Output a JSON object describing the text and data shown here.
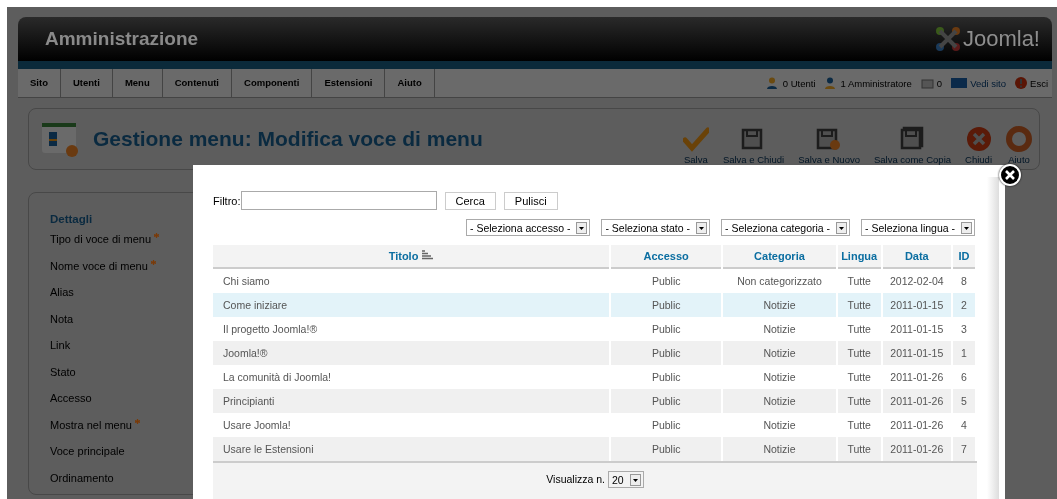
{
  "header": {
    "title": "Amministrazione",
    "logo": "Joomla!"
  },
  "menu": [
    "Sito",
    "Utenti",
    "Menu",
    "Contenuti",
    "Componenti",
    "Estensioni",
    "Aiuto"
  ],
  "status": [
    {
      "kind": "users",
      "text": "0 Utenti"
    },
    {
      "kind": "admins",
      "text": "1 Amministratore"
    },
    {
      "kind": "messages",
      "text": "0"
    },
    {
      "kind": "site",
      "text": "Vedi sito"
    },
    {
      "kind": "logout",
      "text": "Esci"
    }
  ],
  "toolbar": {
    "title": "Gestione menu: Modifica voce di menu",
    "buttons": [
      {
        "kind": "save",
        "label": "Salva"
      },
      {
        "kind": "save-close",
        "label": "Salva e Chiudi"
      },
      {
        "kind": "save-new",
        "label": "Salva e Nuovo"
      },
      {
        "kind": "save-copy",
        "label": "Salva come Copia"
      },
      {
        "kind": "close",
        "label": "Chiudi"
      },
      {
        "kind": "help",
        "label": "Aiuto"
      }
    ]
  },
  "form": {
    "legend": "Dettagli",
    "fields": [
      {
        "label": "Tipo di voce di menu",
        "required": true
      },
      {
        "label": "Nome voce di menu",
        "required": true
      },
      {
        "label": "Alias",
        "required": false
      },
      {
        "label": "Nota",
        "required": false
      },
      {
        "label": "Link",
        "required": false
      },
      {
        "label": "Stato",
        "required": false
      },
      {
        "label": "Accesso",
        "required": false
      },
      {
        "label": "Mostra nel menu",
        "required": true
      },
      {
        "label": "Voce principale",
        "required": false
      },
      {
        "label": "Ordinamento",
        "required": false
      }
    ]
  },
  "modal": {
    "filter_label": "Filtro:",
    "search_button": "Cerca",
    "clear_button": "Pulisci",
    "selects": [
      "- Seleziona accesso -",
      "- Seleziona stato -",
      "- Seleziona categoria -",
      "- Seleziona lingua -"
    ],
    "columns": [
      {
        "label": "Titolo",
        "sorted": true
      },
      {
        "label": "Accesso",
        "sorted": false
      },
      {
        "label": "Categoria",
        "sorted": false
      },
      {
        "label": "Lingua",
        "sorted": false
      },
      {
        "label": "Data",
        "sorted": false
      },
      {
        "label": "ID",
        "sorted": false
      }
    ],
    "rows": [
      {
        "cells": [
          "Chi siamo",
          "Public",
          "Non categorizzato",
          "Tutte",
          "2012-02-04",
          "8"
        ],
        "highlighted": false
      },
      {
        "cells": [
          "Come iniziare",
          "Public",
          "Notizie",
          "Tutte",
          "2011-01-15",
          "2"
        ],
        "highlighted": true
      },
      {
        "cells": [
          "Il progetto Joomla!®",
          "Public",
          "Notizie",
          "Tutte",
          "2011-01-15",
          "3"
        ],
        "highlighted": false
      },
      {
        "cells": [
          "Joomla!®",
          "Public",
          "Notizie",
          "Tutte",
          "2011-01-15",
          "1"
        ],
        "highlighted": false
      },
      {
        "cells": [
          "La comunità di Joomla!",
          "Public",
          "Notizie",
          "Tutte",
          "2011-01-26",
          "6"
        ],
        "highlighted": false
      },
      {
        "cells": [
          "Principianti",
          "Public",
          "Notizie",
          "Tutte",
          "2011-01-26",
          "5"
        ],
        "highlighted": false
      },
      {
        "cells": [
          "Usare Joomla!",
          "Public",
          "Notizie",
          "Tutte",
          "2011-01-26",
          "4"
        ],
        "highlighted": false
      },
      {
        "cells": [
          "Usare le Estensioni",
          "Public",
          "Notizie",
          "Tutte",
          "2011-01-26",
          "7"
        ],
        "highlighted": false
      }
    ],
    "limit_label": "Visualizza n.",
    "limit_value": "20"
  }
}
